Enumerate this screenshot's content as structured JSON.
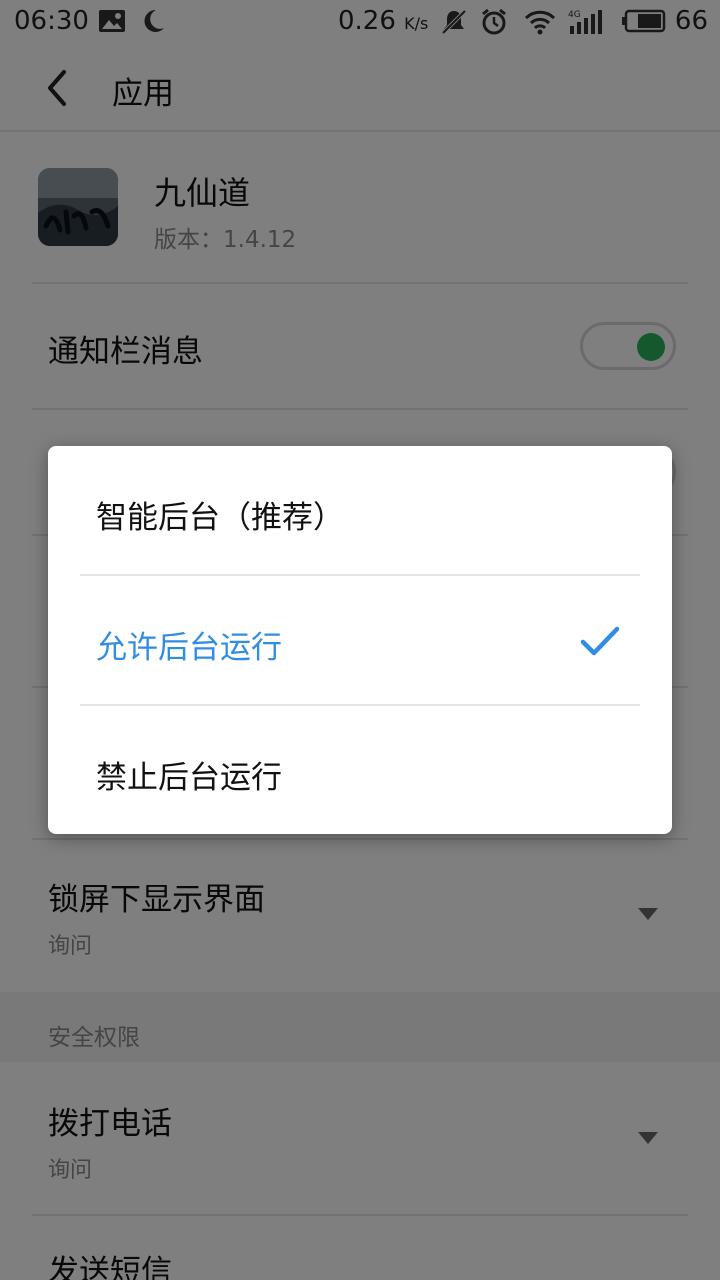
{
  "status_bar": {
    "time": "06:30",
    "net_speed": "0.26",
    "net_speed_unit": "K/s",
    "battery": "66",
    "icons": [
      "gallery-icon",
      "moon-icon",
      "mute-bell-icon",
      "alarm-icon",
      "wifi-icon",
      "4g-signal-icon",
      "battery-icon"
    ]
  },
  "header": {
    "title": "应用"
  },
  "app": {
    "name": "九仙道",
    "version": "版本：1.4.12",
    "icon_text": "九仙道"
  },
  "rows": {
    "notification_title": "通知栏消息",
    "lockscreen_title": "锁屏下显示界面",
    "lockscreen_value": "询问",
    "call_title": "拨打电话",
    "call_value": "询问",
    "sms_title": "发送短信"
  },
  "sections": {
    "security": "安全权限"
  },
  "dialog": {
    "options": [
      {
        "label": "智能后台（推荐）",
        "selected": false
      },
      {
        "label": "允许后台运行",
        "selected": true
      },
      {
        "label": "禁止后台运行",
        "selected": false
      }
    ]
  },
  "colors": {
    "accent": "#2f8de4",
    "toggle_on": "#26b35a",
    "scrim": "rgba(0,0,0,0.5)"
  }
}
